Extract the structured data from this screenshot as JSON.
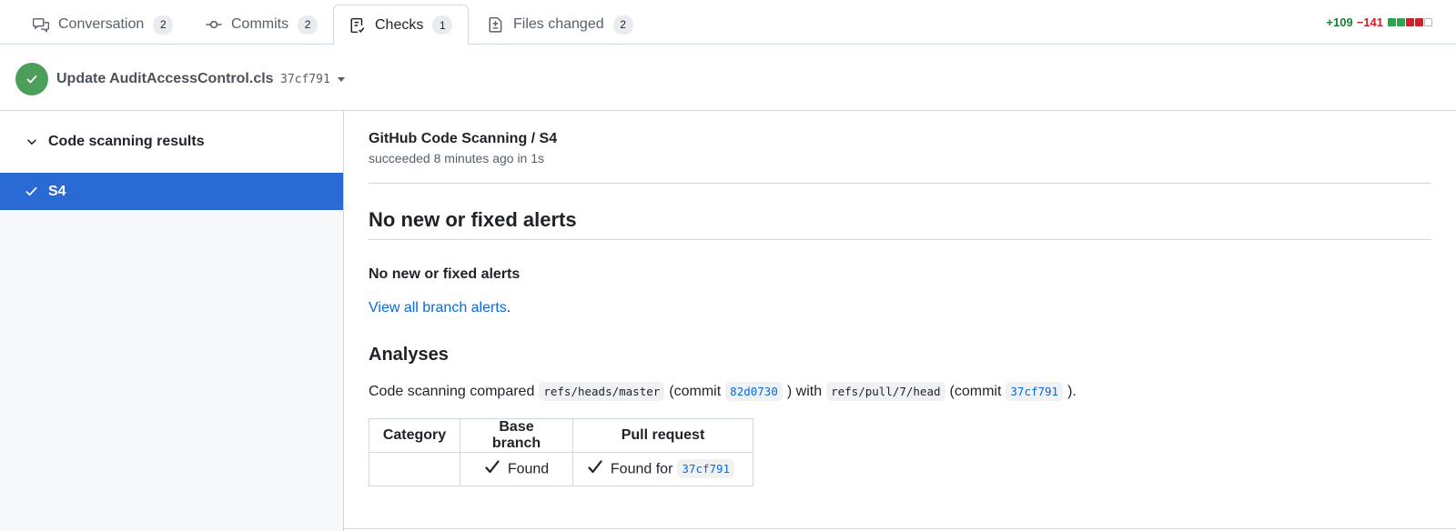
{
  "tabs": [
    {
      "label": "Conversation",
      "count": "2",
      "icon": "comment-discussion-icon"
    },
    {
      "label": "Commits",
      "count": "2",
      "icon": "git-commit-icon"
    },
    {
      "label": "Checks",
      "count": "1",
      "icon": "checklist-icon"
    },
    {
      "label": "Files changed",
      "count": "2",
      "icon": "file-diff-icon"
    }
  ],
  "diffstat": {
    "additions": "+109",
    "deletions": "−141"
  },
  "commit": {
    "title": "Update AuditAccessControl.cls",
    "sha": "37cf791"
  },
  "sidebar": {
    "group_label": "Code scanning results",
    "item_label": "S4"
  },
  "check": {
    "title": "GitHub Code Scanning / S4",
    "subtitle": "succeeded 8 minutes ago in 1s",
    "heading": "No new or fixed alerts",
    "subheading": "No new or fixed alerts",
    "link_text": "View all branch alerts",
    "link_suffix": ".",
    "analyses_heading": "Analyses",
    "compare": {
      "prefix": "Code scanning compared",
      "base_ref": "refs/heads/master",
      "commit_word_1": "(commit",
      "base_sha": "82d0730",
      "with_word": ") with",
      "head_ref": "refs/pull/7/head",
      "commit_word_2": "(commit",
      "head_sha": "37cf791",
      "suffix": ")."
    },
    "table": {
      "headers": [
        "Category",
        "Base branch",
        "Pull request"
      ],
      "row": {
        "category": "",
        "base": "Found",
        "pr_prefix": "Found for",
        "pr_sha": "37cf791"
      }
    }
  },
  "colors": {
    "accent": "#2a6ad4",
    "success": "#4b9f5a",
    "link": "#0969da"
  }
}
